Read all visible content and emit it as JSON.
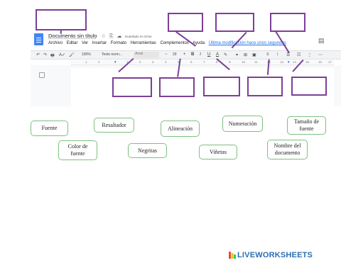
{
  "doc": {
    "title": "Documento sin título",
    "star_icon": "☆",
    "folder_icon": "⎘",
    "cloud_icon": "☁",
    "saved_status": "Guardado en Drive",
    "menu": [
      "Archivo",
      "Editar",
      "Ver",
      "Insertar",
      "Formato",
      "Herramientas",
      "Complementos",
      "Ayuda"
    ],
    "last_edit": "Última modificación hace unos segundos"
  },
  "toolbar": {
    "undo": "↶",
    "redo": "↷",
    "print": "🖶",
    "spell": "A✓",
    "paint": "🖌",
    "zoom": "100%",
    "style": "Texto norm...",
    "font": "Arial",
    "size_minus": "−",
    "size": "29",
    "size_plus": "+",
    "bold": "B",
    "italic": "I",
    "underline": "U",
    "text_color": "A",
    "highlight": "✎",
    "link": "⚭",
    "comment": "⊞",
    "image": "▣",
    "align": "≡",
    "line_spacing": "↕",
    "checklist": "☰",
    "bullets": "☷",
    "numbered": "⋮",
    "more": "⋯"
  },
  "ruler": [
    "1",
    "2",
    "1",
    "2",
    "3",
    "4",
    "5",
    "6",
    "7",
    "8",
    "9",
    "10",
    "11",
    "12",
    "13",
    "14",
    "15",
    "16",
    "17",
    "18"
  ],
  "labels": {
    "fuente": "Fuente",
    "color_de_fuente": "Color de fuente",
    "resaltador": "Resaltador",
    "negritas": "Negritas",
    "alineacion": "Alineación",
    "vinetas": "Viñetas",
    "numeracion": "Numeración",
    "nombre_del_documento": "Nombre del documento",
    "tamano_de_fuente": "Tamaño de fuente"
  },
  "watermark": "LIVEWORKSHEETS",
  "colors": {
    "box_border": "#7b3f98",
    "label_border": "#7fc07f",
    "watermark": "#2b6fb3"
  }
}
